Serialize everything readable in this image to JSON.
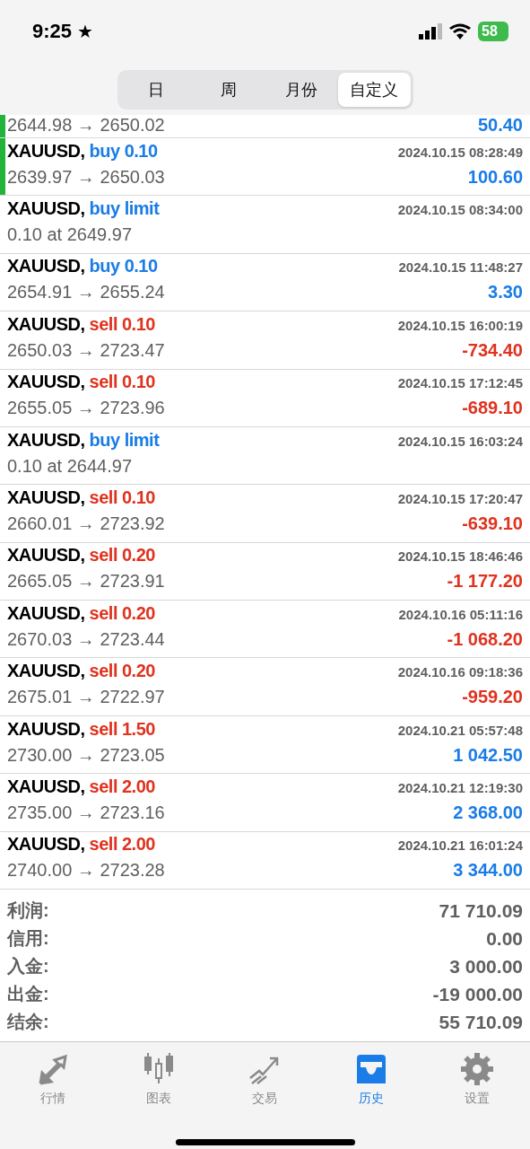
{
  "status_bar": {
    "time": "9:25",
    "star": "★",
    "battery": "58"
  },
  "segments": [
    {
      "label": "日",
      "selected": false
    },
    {
      "label": "周",
      "selected": false
    },
    {
      "label": "月份",
      "selected": false
    },
    {
      "label": "自定义",
      "selected": true
    }
  ],
  "partial_row": {
    "prices": "2644.98 → 2650.02",
    "profit": {
      "text": "50.40",
      "color": "#1a7ce6"
    },
    "highlighted": true
  },
  "deals": [
    {
      "symbol": "XAUUSD,",
      "action": {
        "text": "buy 0.10",
        "color": "#1a7ce6"
      },
      "time": "2024.10.15 08:28:49",
      "prices": "2639.97 → 2650.03",
      "profit": {
        "text": "100.60",
        "color": "#1a7ce6"
      },
      "highlighted": true
    },
    {
      "symbol": "XAUUSD,",
      "action": {
        "text": "buy limit",
        "color": "#1a7ce6"
      },
      "time": "2024.10.15 08:34:00",
      "prices": "0.10 at 2649.97",
      "highlighted": false
    },
    {
      "symbol": "XAUUSD,",
      "action": {
        "text": "buy 0.10",
        "color": "#1a7ce6"
      },
      "time": "2024.10.15 11:48:27",
      "prices": "2654.91 → 2655.24",
      "profit": {
        "text": "3.30",
        "color": "#1a7ce6"
      },
      "highlighted": false
    },
    {
      "symbol": "XAUUSD,",
      "action": {
        "text": "sell 0.10",
        "color": "#e0321e"
      },
      "time": "2024.10.15 16:00:19",
      "prices": "2650.03 → 2723.47",
      "profit": {
        "text": "-734.40",
        "color": "#e0321e"
      },
      "highlighted": false
    },
    {
      "symbol": "XAUUSD,",
      "action": {
        "text": "sell 0.10",
        "color": "#e0321e"
      },
      "time": "2024.10.15 17:12:45",
      "prices": "2655.05 → 2723.96",
      "profit": {
        "text": "-689.10",
        "color": "#e0321e"
      },
      "highlighted": false
    },
    {
      "symbol": "XAUUSD,",
      "action": {
        "text": "buy limit",
        "color": "#1a7ce6"
      },
      "time": "2024.10.15 16:03:24",
      "prices": "0.10 at 2644.97",
      "highlighted": false
    },
    {
      "symbol": "XAUUSD,",
      "action": {
        "text": "sell 0.10",
        "color": "#e0321e"
      },
      "time": "2024.10.15 17:20:47",
      "prices": "2660.01 → 2723.92",
      "profit": {
        "text": "-639.10",
        "color": "#e0321e"
      },
      "highlighted": false
    },
    {
      "symbol": "XAUUSD,",
      "action": {
        "text": "sell 0.20",
        "color": "#e0321e"
      },
      "time": "2024.10.15 18:46:46",
      "prices": "2665.05 → 2723.91",
      "profit": {
        "text": "-1 177.20",
        "color": "#e0321e"
      },
      "highlighted": false
    },
    {
      "symbol": "XAUUSD,",
      "action": {
        "text": "sell 0.20",
        "color": "#e0321e"
      },
      "time": "2024.10.16 05:11:16",
      "prices": "2670.03 → 2723.44",
      "profit": {
        "text": "-1 068.20",
        "color": "#e0321e"
      },
      "highlighted": false
    },
    {
      "symbol": "XAUUSD,",
      "action": {
        "text": "sell 0.20",
        "color": "#e0321e"
      },
      "time": "2024.10.16 09:18:36",
      "prices": "2675.01 → 2722.97",
      "profit": {
        "text": "-959.20",
        "color": "#e0321e"
      },
      "highlighted": false
    },
    {
      "symbol": "XAUUSD,",
      "action": {
        "text": "sell 1.50",
        "color": "#e0321e"
      },
      "time": "2024.10.21 05:57:48",
      "prices": "2730.00 → 2723.05",
      "profit": {
        "text": "1 042.50",
        "color": "#1a7ce6"
      },
      "highlighted": false
    },
    {
      "symbol": "XAUUSD,",
      "action": {
        "text": "sell 2.00",
        "color": "#e0321e"
      },
      "time": "2024.10.21 12:19:30",
      "prices": "2735.00 → 2723.16",
      "profit": {
        "text": "2 368.00",
        "color": "#1a7ce6"
      },
      "highlighted": false
    },
    {
      "symbol": "XAUUSD,",
      "action": {
        "text": "sell 2.00",
        "color": "#e0321e"
      },
      "time": "2024.10.21 16:01:24",
      "prices": "2740.00 → 2723.28",
      "profit": {
        "text": "3 344.00",
        "color": "#1a7ce6"
      },
      "highlighted": false
    }
  ],
  "summary": [
    {
      "label": "利润:",
      "value": "71 710.09"
    },
    {
      "label": "信用:",
      "value": "0.00"
    },
    {
      "label": "入金:",
      "value": "3 000.00"
    },
    {
      "label": "出金:",
      "value": "-19 000.00"
    },
    {
      "label": "结余:",
      "value": "55 710.09"
    }
  ],
  "tab_bar": [
    {
      "label": "行情",
      "selected": false
    },
    {
      "label": "图表",
      "selected": false
    },
    {
      "label": "交易",
      "selected": false
    },
    {
      "label": "历史",
      "selected": true
    },
    {
      "label": "设置",
      "selected": false
    }
  ]
}
